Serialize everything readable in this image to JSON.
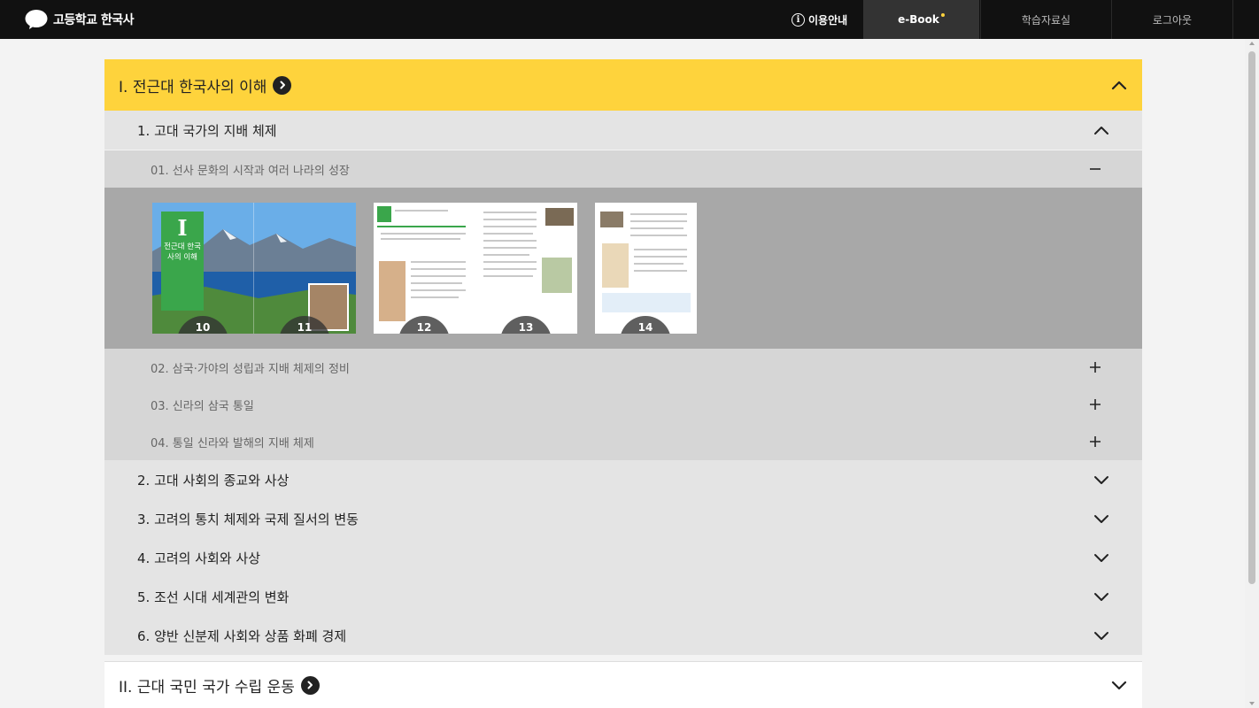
{
  "header": {
    "app_title": "고등학교 한국사",
    "guide_label": "이용안내",
    "tabs": [
      {
        "label": "e-Book",
        "active": true
      },
      {
        "label": "학습자료실",
        "active": false
      },
      {
        "label": "로그아웃",
        "active": false
      }
    ],
    "accent_color": "#fed33c"
  },
  "units": [
    {
      "title": "I. 전근대 한국사의 이해",
      "expanded": true,
      "chapters": [
        {
          "title": "1. 고대 국가의 지배 체제",
          "expanded": true,
          "sections": [
            {
              "title": "01. 선사 문화의 시작과 여러 나라의 성장",
              "expanded": true,
              "pages": [
                "10",
                "11",
                "12",
                "13",
                "14"
              ],
              "cover_text": "I",
              "cover_subtitle": "전근대 한국사의 이해"
            },
            {
              "title": "02. 삼국·가야의 성립과 지배 체제의 정비",
              "expanded": false
            },
            {
              "title": "03. 신라의 삼국 통일",
              "expanded": false
            },
            {
              "title": "04. 통일 신라와 발해의 지배 체제",
              "expanded": false
            }
          ]
        },
        {
          "title": "2. 고대 사회의 종교와 사상",
          "expanded": false
        },
        {
          "title": "3. 고려의 통치 체제와 국제 질서의 변동",
          "expanded": false
        },
        {
          "title": "4. 고려의 사회와 사상",
          "expanded": false
        },
        {
          "title": "5. 조선 시대 세계관의 변화",
          "expanded": false
        },
        {
          "title": "6. 양반 신분제 사회와 상품 화폐 경제",
          "expanded": false
        }
      ]
    },
    {
      "title": "II. 근대 국민 국가 수립 운동",
      "expanded": false
    }
  ]
}
